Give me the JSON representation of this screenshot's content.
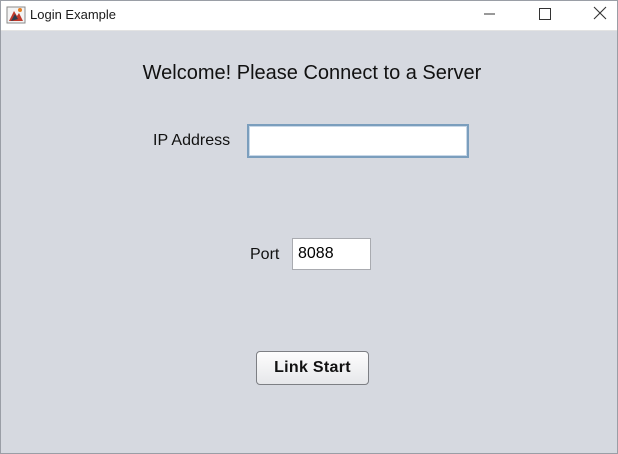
{
  "window": {
    "title": "Login Example",
    "icon": "java-app-icon",
    "controls": [
      "minimize-icon",
      "maximize-icon",
      "close-icon"
    ]
  },
  "form": {
    "heading": "Welcome! Please Connect to a Server",
    "ip_label": "IP Address",
    "ip_value": "",
    "port_label": "Port",
    "port_value": "8088",
    "submit_label": "Link Start"
  },
  "colors": {
    "background": "#d6d9e0",
    "titlebar": "#ffffff",
    "focus_border": "#7b9ebd"
  }
}
